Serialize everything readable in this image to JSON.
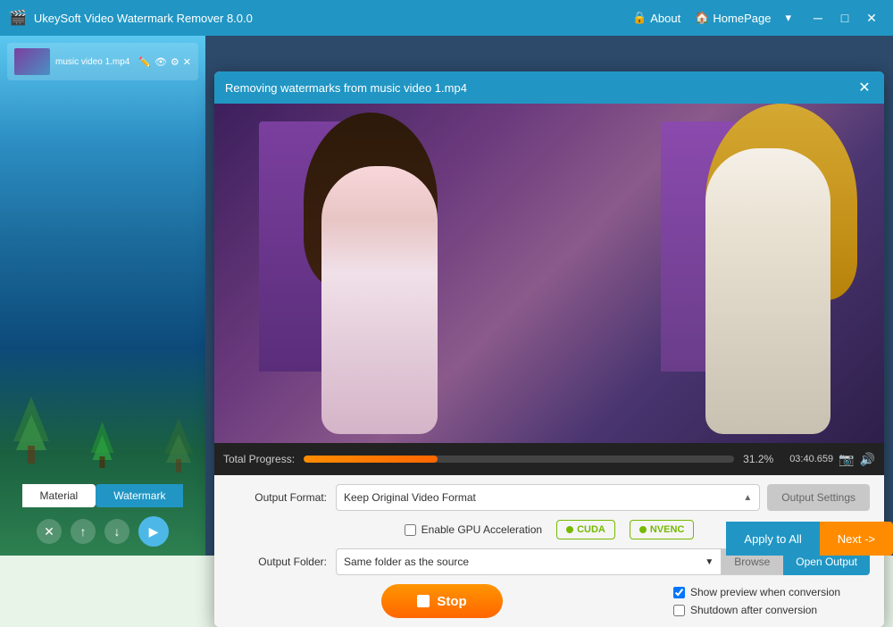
{
  "app": {
    "title": "UkeySoft Video Watermark Remover 8.0.0",
    "logo_char": "🎬"
  },
  "titlebar": {
    "about_label": "About",
    "homepage_label": "HomePage",
    "minimize_label": "─",
    "maximize_label": "□",
    "close_label": "✕"
  },
  "sidebar": {
    "material_tab": "Material",
    "watermark_tab": "Watermark",
    "delete_btn": "✕",
    "up_btn": "↑",
    "down_btn": "↓",
    "play_btn": "▶"
  },
  "dialog": {
    "title": "Removing watermarks from music video 1.mp4",
    "close_label": "✕",
    "progress_label": "Total Progress:",
    "progress_value": 31.2,
    "progress_text": "31.2%"
  },
  "controls": {
    "output_format_label": "Output Format:",
    "output_format_value": "Keep Original Video Format",
    "output_settings_label": "Output Settings",
    "enable_gpu_label": "Enable GPU Acceleration",
    "cuda_label": "CUDA",
    "nvenc_label": "NVENC",
    "output_folder_label": "Output Folder:",
    "output_folder_value": "Same folder as the source",
    "browse_label": "Browse",
    "open_output_label": "Open Output",
    "stop_label": "Stop"
  },
  "right_options": {
    "show_preview_label": "Show preview when conversion",
    "shutdown_label": "Shutdown after conversion",
    "show_preview_checked": true,
    "shutdown_checked": false
  },
  "bottom": {
    "apply_all_label": "Apply to All",
    "next_label": "Next ->"
  },
  "playback": {
    "time": "03:40.659"
  }
}
